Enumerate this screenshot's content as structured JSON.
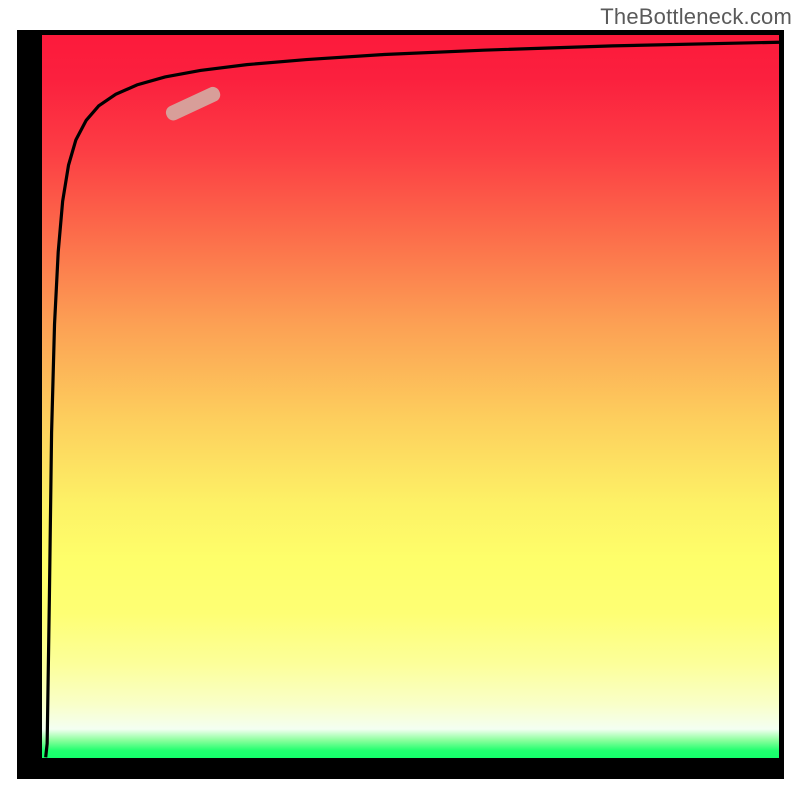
{
  "attribution": "TheBottleneck.com",
  "colors": {
    "top": "#fc1a3b",
    "mid": "#fdf266",
    "bottom": "#14ff6b",
    "border": "#000000",
    "curve": "#000000",
    "marker": "#d89e99"
  },
  "chart_data": {
    "type": "line",
    "title": "",
    "xlabel": "",
    "ylabel": "",
    "xlim": [
      0,
      100
    ],
    "ylim": [
      0,
      100
    ],
    "x": [
      0.5,
      0.7,
      1.0,
      1.3,
      1.7,
      2.2,
      2.8,
      3.6,
      4.6,
      6.0,
      7.7,
      10.0,
      12.9,
      16.7,
      21.5,
      27.8,
      35.9,
      46.4,
      59.9,
      77.4,
      100.0
    ],
    "values": [
      0.1,
      2.0,
      22.0,
      45.0,
      60.0,
      70.0,
      77.0,
      82.0,
      85.5,
      88.2,
      90.2,
      91.8,
      93.1,
      94.2,
      95.1,
      95.9,
      96.6,
      97.3,
      97.9,
      98.5,
      99.0
    ],
    "marker": {
      "x_center": 20.5,
      "y_center": 90.5,
      "angle_deg": -25
    },
    "gradient_axis": "y",
    "gradient_stops": [
      {
        "y": 100,
        "color": "#fc1a3b"
      },
      {
        "y": 50,
        "color": "#fdce5d"
      },
      {
        "y": 20,
        "color": "#feff74"
      },
      {
        "y": 2,
        "color": "#1fff6e"
      },
      {
        "y": 0,
        "color": "#14ff6b"
      }
    ]
  }
}
